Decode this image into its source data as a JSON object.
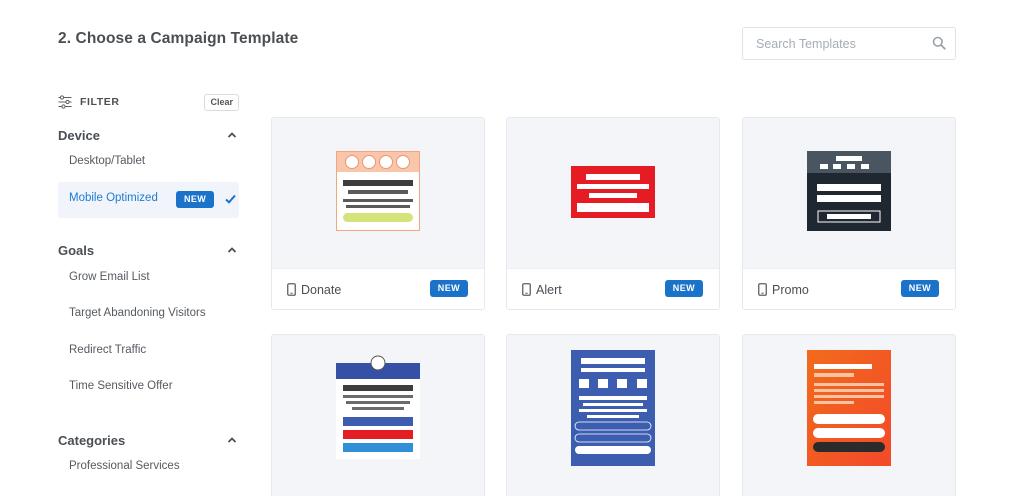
{
  "header": {
    "title": "2. Choose a Campaign Template"
  },
  "search": {
    "placeholder": "Search Templates"
  },
  "sidebar": {
    "filter_label": "FILTER",
    "clear_label": "Clear",
    "device": {
      "heading": "Device",
      "items": [
        {
          "label": "Desktop/Tablet"
        },
        {
          "label": "Mobile Optimized",
          "badge": "NEW",
          "selected": true
        }
      ]
    },
    "goals": {
      "heading": "Goals",
      "items": [
        {
          "label": "Grow Email List"
        },
        {
          "label": "Target Abandoning Visitors"
        },
        {
          "label": "Redirect Traffic"
        },
        {
          "label": "Time Sensitive Offer"
        }
      ]
    },
    "categories": {
      "heading": "Categories",
      "items": [
        {
          "label": "Professional Services"
        }
      ]
    }
  },
  "templates": [
    {
      "name": "Donate",
      "badge": "NEW",
      "icon": "mobile-icon"
    },
    {
      "name": "Alert",
      "badge": "NEW",
      "icon": "mobile-icon"
    },
    {
      "name": "Promo",
      "badge": "NEW",
      "icon": "mobile-icon"
    }
  ],
  "colors": {
    "accent": "#1a73c9",
    "active_bg": "#f1f5fb",
    "card_preview_bg": "#f3f5f8",
    "alert_red": "#e51c23",
    "promo_dark": "#1f2830",
    "donate_peach": "#f6b693",
    "blue_card": "#3d5db0",
    "orange_card": "#f45d1d"
  }
}
